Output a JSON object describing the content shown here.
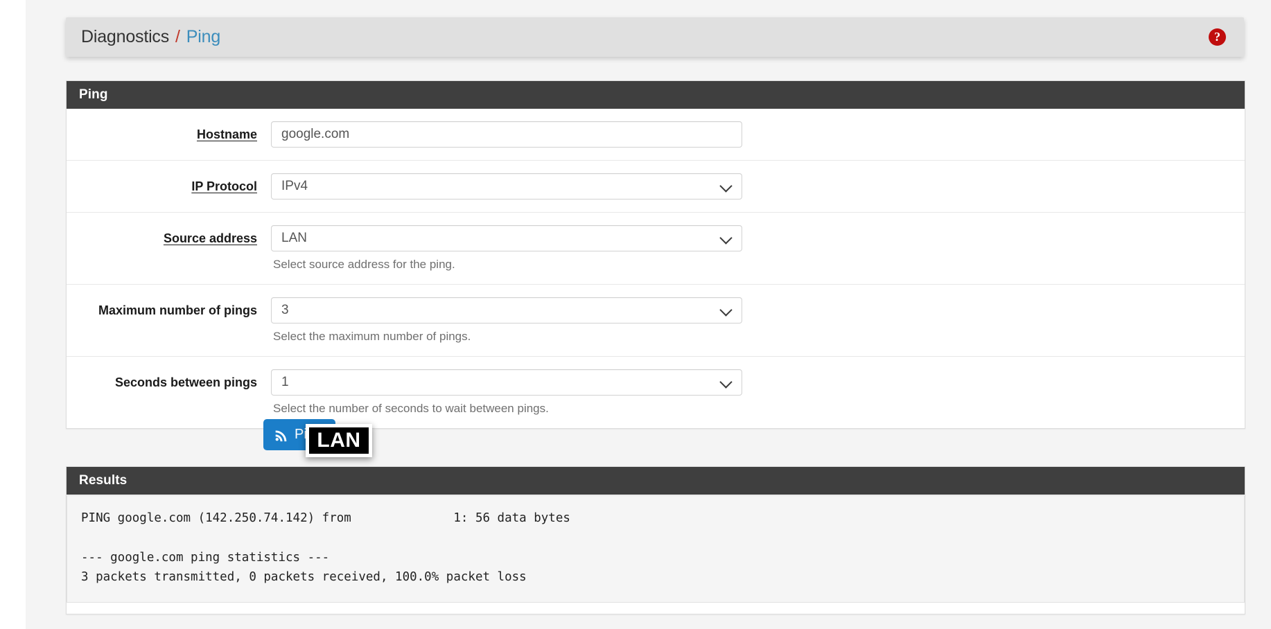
{
  "breadcrumb": {
    "root": "Diagnostics",
    "separator": "/",
    "current": "Ping",
    "help_icon": "question-mark-circle-icon",
    "help_glyph": "?"
  },
  "ping_panel": {
    "title": "Ping",
    "fields": [
      {
        "label": "Hostname",
        "underlined": true,
        "type": "text",
        "value": "google.com",
        "placeholder": "",
        "help": ""
      },
      {
        "label": "IP Protocol",
        "underlined": true,
        "type": "select",
        "value": "IPv4",
        "help": ""
      },
      {
        "label": "Source address",
        "underlined": true,
        "type": "select",
        "value": "LAN",
        "help": "Select source address for the ping."
      },
      {
        "label": "Maximum number of pings",
        "underlined": false,
        "type": "select",
        "value": "3",
        "help": "Select the maximum number of pings."
      },
      {
        "label": "Seconds between pings",
        "underlined": false,
        "type": "select",
        "value": "1",
        "help": "Select the number of seconds to wait between pings."
      }
    ]
  },
  "actions": {
    "ping_button_label": "Ping",
    "ping_button_icon": "rss-signal-icon",
    "ping_button_color": "#1b7ec9"
  },
  "results_panel": {
    "title": "Results",
    "output": "PING google.com (142.250.74.142) from              1: 56 data bytes\n\n--- google.com ping statistics ---\n3 packets transmitted, 0 packets received, 100.0% packet loss"
  },
  "annotation": {
    "label": "LAN"
  },
  "colors": {
    "panel_header": "#3f3f3f",
    "breadcrumb_link": "#3c8dbc",
    "breadcrumb_separator": "#c0392b",
    "help_icon": "#c00d0d",
    "page_background": "#f4f4f4"
  }
}
